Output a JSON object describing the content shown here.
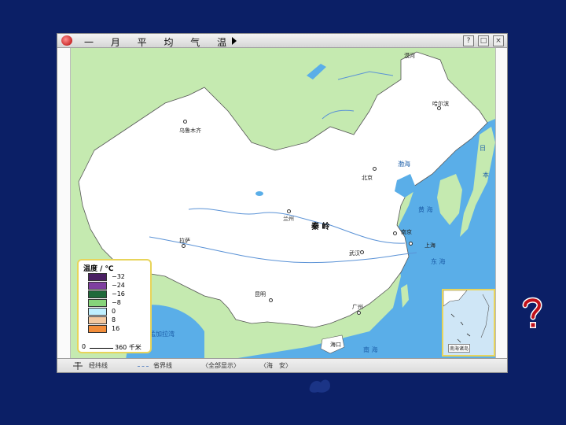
{
  "window": {
    "title": "一 月 平 均 气 温",
    "buttons": [
      "?",
      "□",
      "×"
    ]
  },
  "map": {
    "places": {
      "mohe": "漠河",
      "harbin": "哈尔滨",
      "urumqi": "乌鲁木齐",
      "beijing": "北京",
      "lanzhou": "兰州",
      "lhasa": "拉萨",
      "nanjing": "南京",
      "shanghai": "上海",
      "wuhan": "武汉",
      "kunming": "昆明",
      "guangzhou": "广州",
      "haikou": "海口"
    },
    "range": "秦 岭",
    "seas": {
      "bohai": "渤海",
      "huanghai": "黄 海",
      "donghai": "东 海",
      "nanhai": "南 海",
      "bengal": "孟加拉湾",
      "japan_1": "日",
      "japan_2": "本"
    },
    "inset_label": "南海诸岛"
  },
  "legend": {
    "title": "温度 / ℃",
    "items": [
      {
        "label": "−32",
        "color": "#4a1f63"
      },
      {
        "label": "−24",
        "color": "#7f3fa0"
      },
      {
        "label": "−16",
        "color": "#1f6a3a"
      },
      {
        "label": "−8",
        "color": "#86d47a"
      },
      {
        "label": "0",
        "color": "#bfefff"
      },
      {
        "label": "8",
        "color": "#f3c8a0"
      },
      {
        "label": "16",
        "color": "#f28d3a"
      }
    ],
    "scale_zero": "0",
    "scale_text": "360 千米"
  },
  "statusbar": {
    "grid": "经纬线",
    "border": "省界线",
    "show_all": "〈全部显示〉",
    "sea": "〈海　安〉"
  },
  "colors": {
    "background": "#0b1f66",
    "land": "#ffffff",
    "sea": "#5aaee8",
    "neighbor": "#c5eab0"
  }
}
